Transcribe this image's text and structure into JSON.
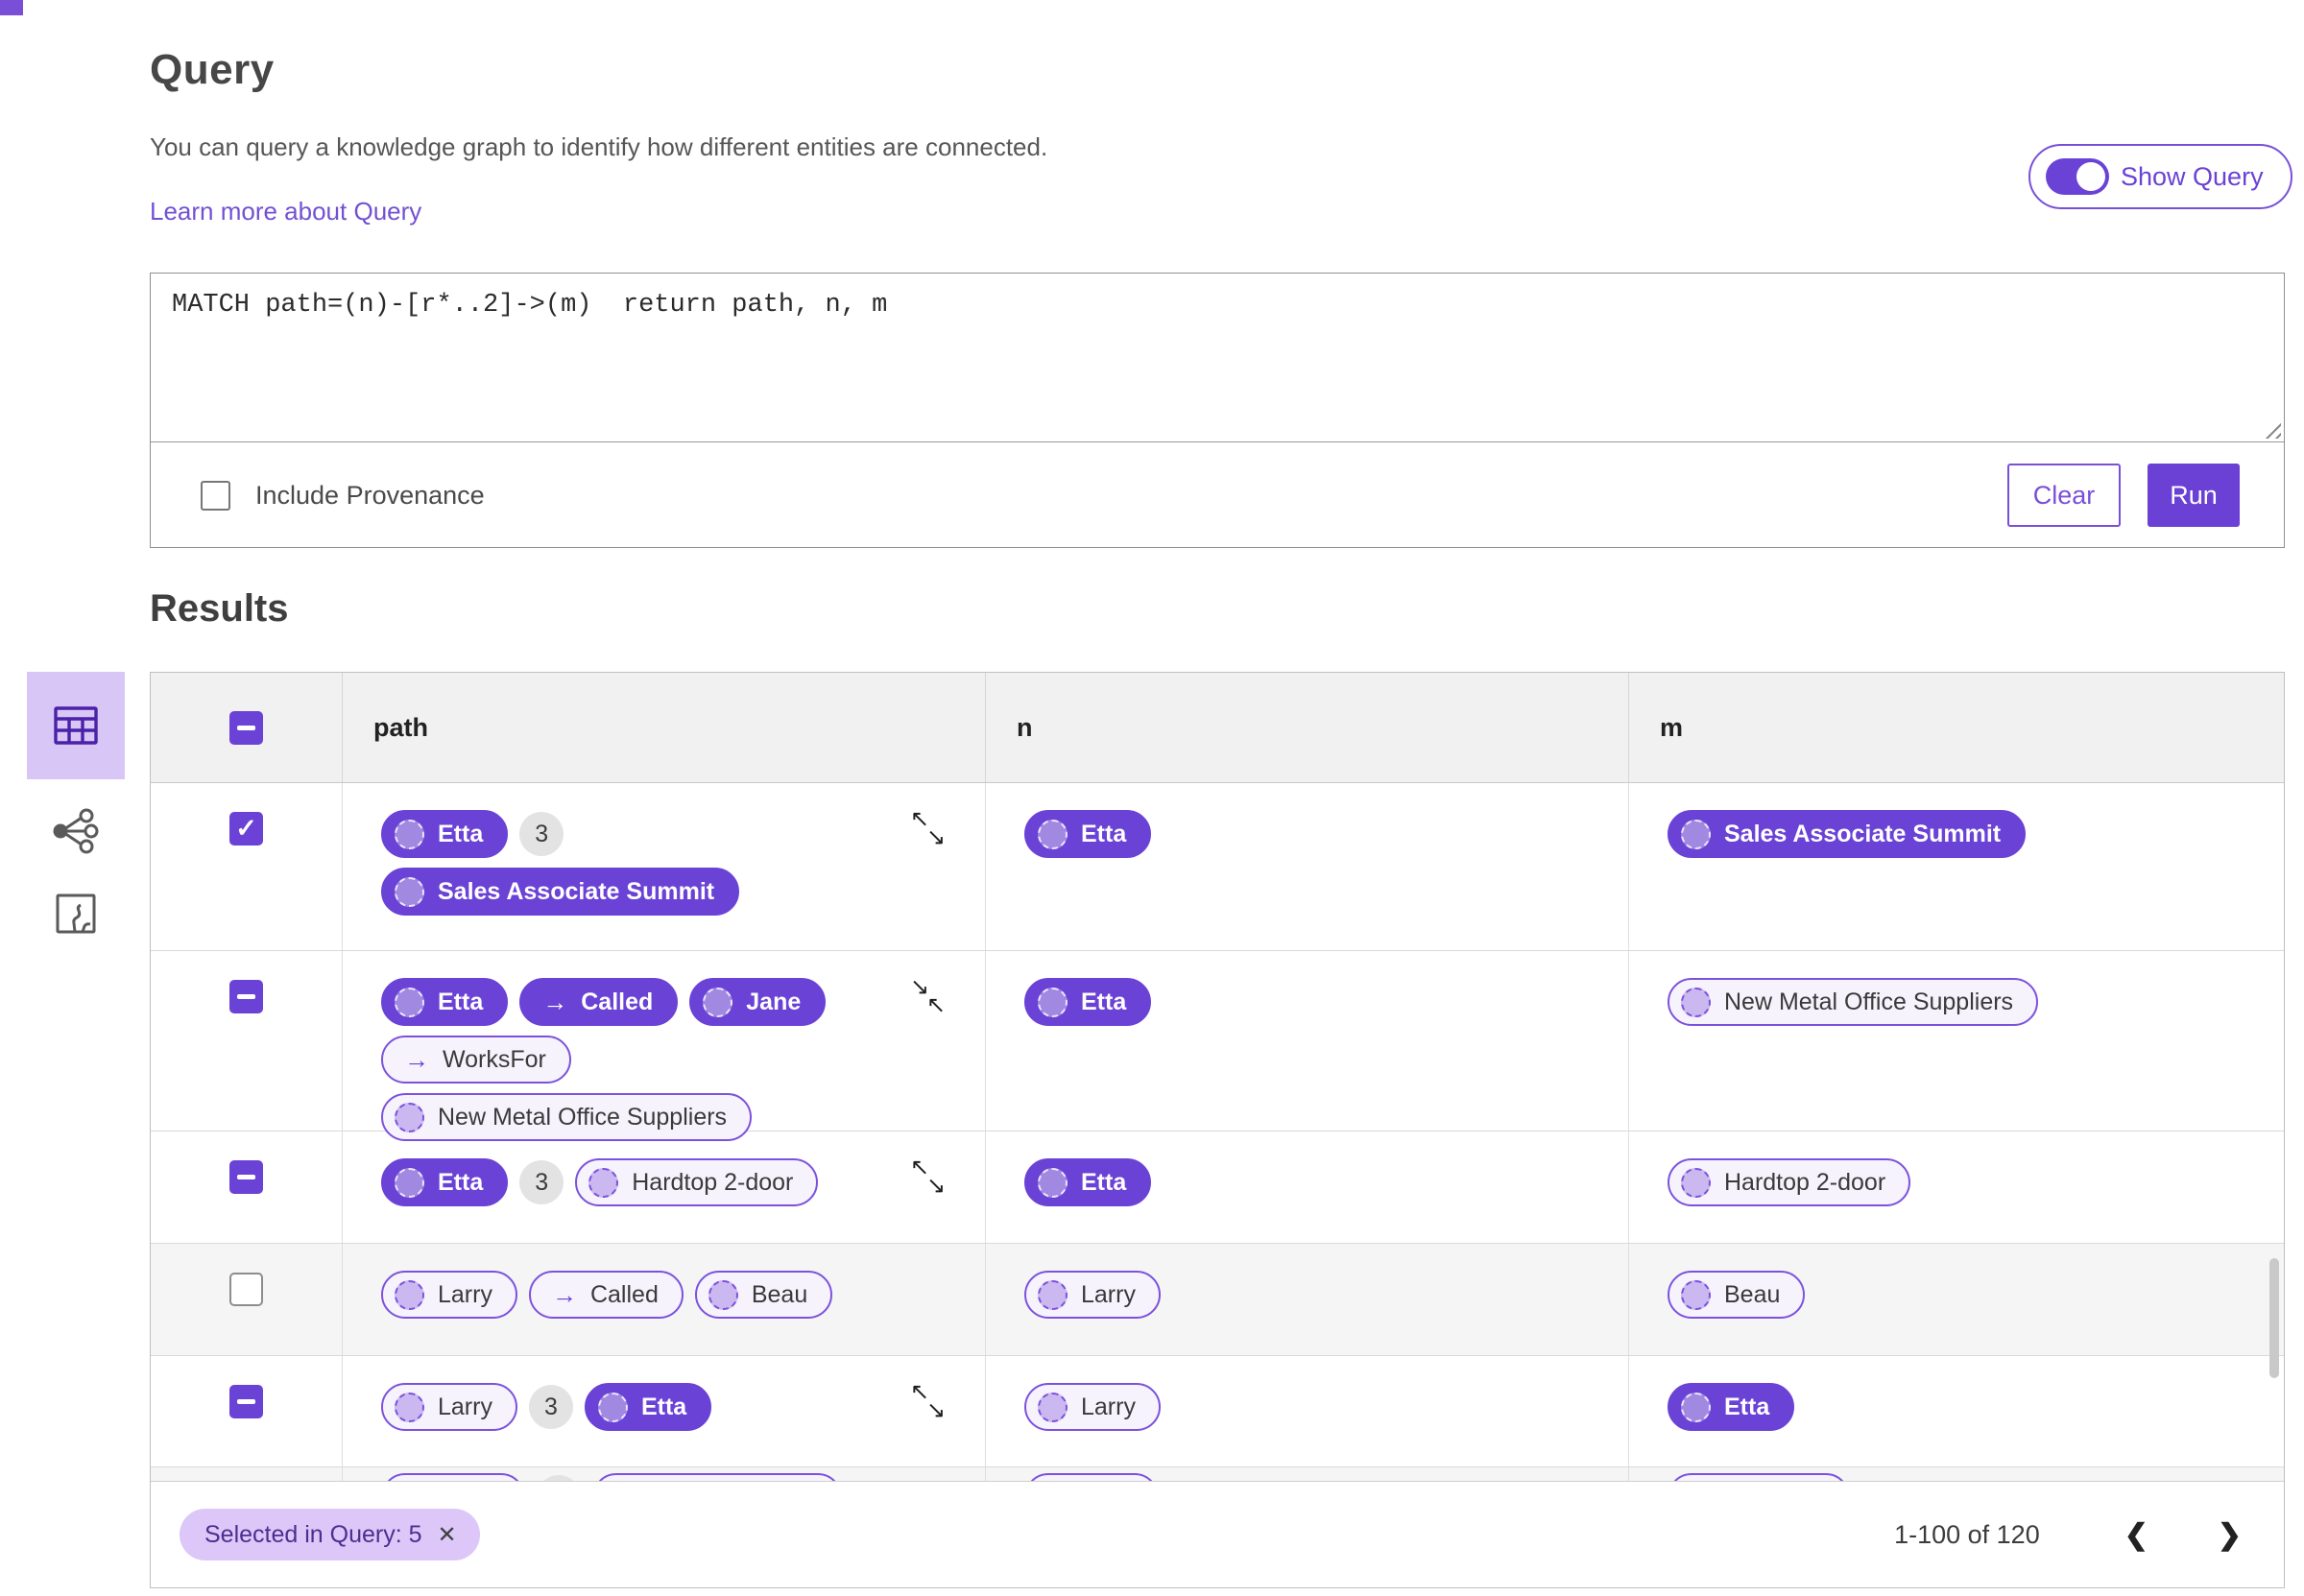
{
  "query": {
    "title": "Query",
    "description": "You can query a knowledge graph to identify how different entities are connected.",
    "learn_more_label": "Learn more about Query",
    "show_query_label": "Show Query",
    "show_query_on": true,
    "query_text": "MATCH path=(n)-[r*..2]->(m)  return path, n, m",
    "include_provenance_label": "Include Provenance",
    "include_provenance_checked": false,
    "clear_label": "Clear",
    "run_label": "Run"
  },
  "results": {
    "title": "Results",
    "view_icons": [
      "table-view-icon",
      "graph-view-icon",
      "map-view-icon"
    ],
    "active_view": "table",
    "columns": [
      "path",
      "n",
      "m"
    ],
    "header_checkbox_state": "indeterminate",
    "rows": [
      {
        "select_state": "checked",
        "shade": false,
        "resize_icon": "expand",
        "path_lines": [
          [
            {
              "kind": "node",
              "label": "Etta",
              "filled": true
            },
            {
              "kind": "count",
              "label": "3"
            }
          ],
          [
            {
              "kind": "node",
              "label": "Sales Associate Summit",
              "filled": true
            }
          ]
        ],
        "n": [
          {
            "kind": "node",
            "label": "Etta",
            "filled": true
          }
        ],
        "m": [
          {
            "kind": "node",
            "label": "Sales Associate Summit",
            "filled": true
          }
        ]
      },
      {
        "select_state": "indeterminate",
        "shade": false,
        "resize_icon": "collapse",
        "path_lines": [
          [
            {
              "kind": "node",
              "label": "Etta",
              "filled": true
            },
            {
              "kind": "edge",
              "label": "Called",
              "filled": true
            },
            {
              "kind": "node",
              "label": "Jane",
              "filled": true
            }
          ],
          [
            {
              "kind": "edge",
              "label": "WorksFor",
              "filled": false
            }
          ],
          [
            {
              "kind": "node",
              "label": "New Metal Office Suppliers",
              "filled": false
            }
          ]
        ],
        "n": [
          {
            "kind": "node",
            "label": "Etta",
            "filled": true
          }
        ],
        "m": [
          {
            "kind": "node",
            "label": "New Metal Office Suppliers",
            "filled": false
          }
        ]
      },
      {
        "select_state": "indeterminate",
        "shade": false,
        "resize_icon": "expand",
        "path_lines": [
          [
            {
              "kind": "node",
              "label": "Etta",
              "filled": true
            },
            {
              "kind": "count",
              "label": "3"
            },
            {
              "kind": "node",
              "label": "Hardtop 2-door",
              "filled": false
            }
          ]
        ],
        "n": [
          {
            "kind": "node",
            "label": "Etta",
            "filled": true
          }
        ],
        "m": [
          {
            "kind": "node",
            "label": "Hardtop 2-door",
            "filled": false
          }
        ]
      },
      {
        "select_state": "unchecked",
        "shade": true,
        "resize_icon": null,
        "path_lines": [
          [
            {
              "kind": "node",
              "label": "Larry",
              "filled": false
            },
            {
              "kind": "edge",
              "label": "Called",
              "filled": false
            },
            {
              "kind": "node",
              "label": "Beau",
              "filled": false
            }
          ]
        ],
        "n": [
          {
            "kind": "node",
            "label": "Larry",
            "filled": false
          }
        ],
        "m": [
          {
            "kind": "node",
            "label": "Beau",
            "filled": false
          }
        ]
      },
      {
        "select_state": "indeterminate",
        "shade": false,
        "resize_icon": "expand",
        "path_lines": [
          [
            {
              "kind": "node",
              "label": "Larry",
              "filled": false
            },
            {
              "kind": "count",
              "label": "3"
            },
            {
              "kind": "node",
              "label": "Etta",
              "filled": true
            }
          ]
        ],
        "n": [
          {
            "kind": "node",
            "label": "Larry",
            "filled": false
          }
        ],
        "m": [
          {
            "kind": "node",
            "label": "Etta",
            "filled": true
          }
        ]
      },
      {
        "select_state": null,
        "shade": true,
        "resize_icon": null,
        "partial": true,
        "path_lines": [
          [
            {
              "kind": "node",
              "label": "",
              "filled": false,
              "min_width": 150
            },
            {
              "kind": "count",
              "label": ""
            },
            {
              "kind": "node",
              "label": "",
              "filled": false,
              "min_width": 260
            }
          ]
        ],
        "n": [
          {
            "kind": "node",
            "label": "",
            "filled": false,
            "min_width": 140
          }
        ],
        "m": [
          {
            "kind": "node",
            "label": "",
            "filled": false,
            "min_width": 190
          }
        ]
      }
    ],
    "footer": {
      "chip_label": "Selected in Query: 5",
      "pagination_range": "1-100 of 120"
    }
  },
  "colors": {
    "primary_purple": "#6b42d6",
    "outline_purple": "#7c52dd",
    "light_purple_bg": "#dcc7f8",
    "selected_view_bg": "#d8c6f6",
    "header_gray": "#f1f1f1",
    "shade_row": "#f5f5f5"
  }
}
